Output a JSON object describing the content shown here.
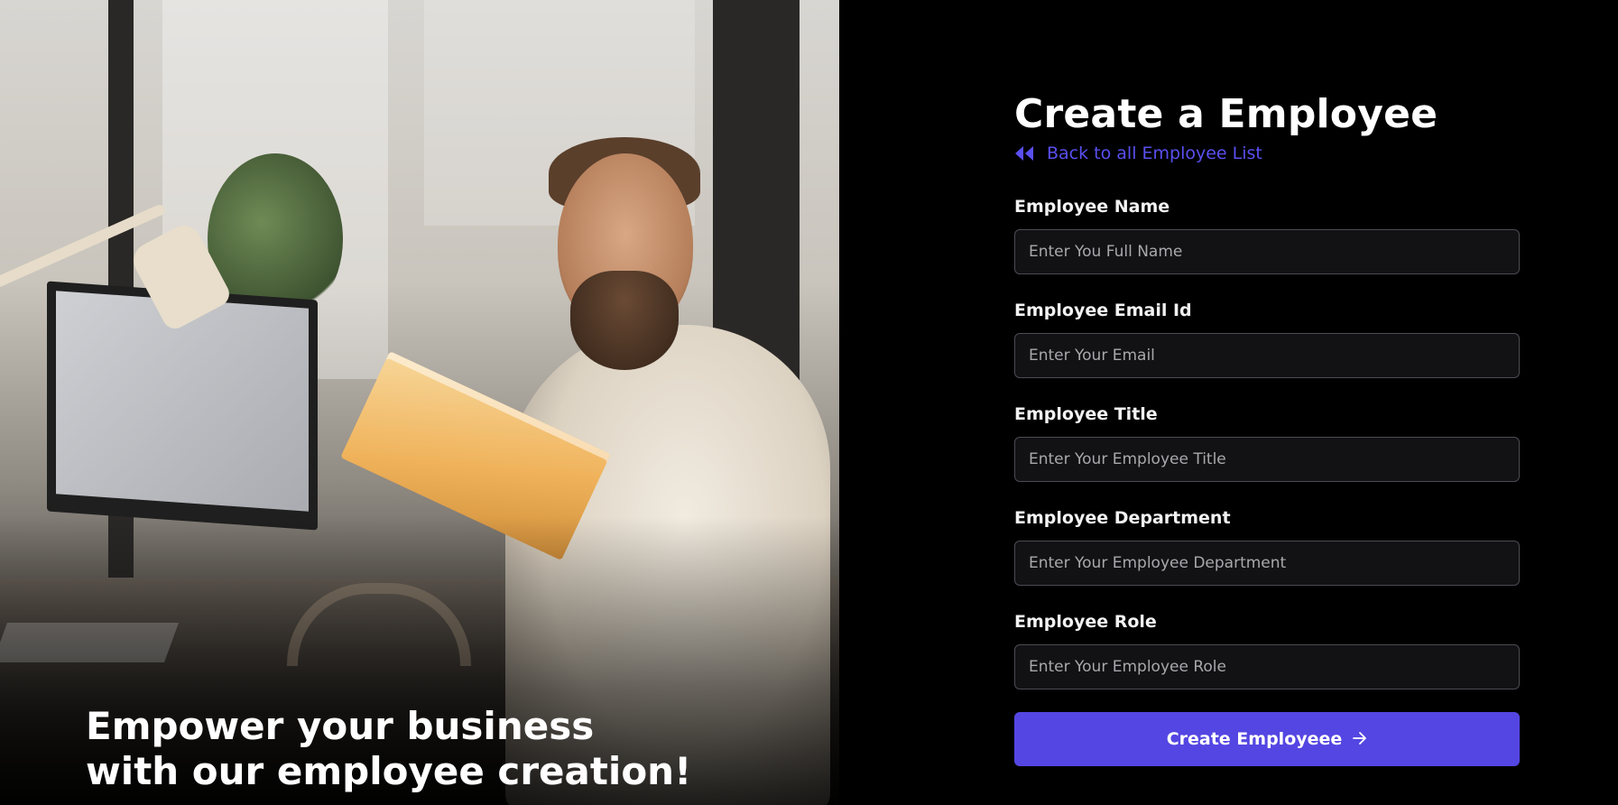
{
  "hero": {
    "tagline_line1": "Empower your business",
    "tagline_line2": "with our employee creation!"
  },
  "form": {
    "title": "Create a Employee",
    "back_link": {
      "label": "Back to all Employee List",
      "icon": "double-chevron-left-icon"
    },
    "fields": [
      {
        "label": "Employee Name",
        "placeholder": "Enter You Full Name",
        "value": ""
      },
      {
        "label": "Employee Email Id",
        "placeholder": "Enter Your Email",
        "value": ""
      },
      {
        "label": "Employee Title",
        "placeholder": "Enter Your Employee Title",
        "value": ""
      },
      {
        "label": "Employee Department",
        "placeholder": "Enter Your Employee Department",
        "value": ""
      },
      {
        "label": "Employee Role",
        "placeholder": "Enter Your Employee Role",
        "value": ""
      }
    ],
    "submit": {
      "label": "Create Employeee",
      "icon": "arrow-right-icon"
    }
  },
  "colors": {
    "accent": "#5446e2",
    "link": "#5a4ff0",
    "background": "#000000",
    "input_bg": "#121215",
    "input_border": "#4b4b52"
  }
}
